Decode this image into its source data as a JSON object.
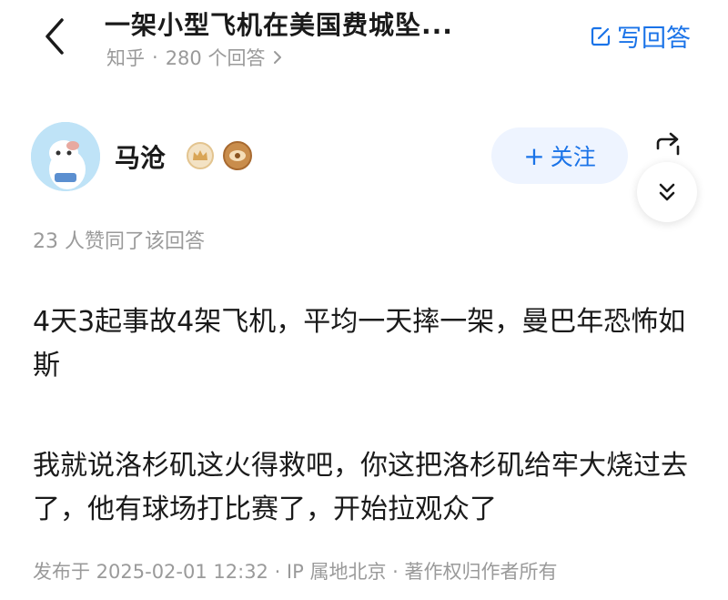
{
  "header": {
    "title": "一架小型飞机在美国费城坠...",
    "source": "知乎",
    "separator": "·",
    "answer_count": "280 个回答",
    "write_answer_label": "写回答",
    "accent_color": "#1a73e8"
  },
  "author": {
    "name": "马沧",
    "follow_label": "关注",
    "follow_plus": "+"
  },
  "answer": {
    "agree_text": "23 人赞同了该回答",
    "paragraphs": [
      "4天3起事故4架飞机，平均一天摔一架，曼巴年恐怖如斯",
      "我就说洛杉矶这火得救吧，你这把洛杉矶给牢大烧过去了，他有球场打比赛了，开始拉观众了"
    ],
    "footer": "发布于 2025-02-01 12:32 · IP 属地北京 · 著作权归作者所有"
  },
  "icons": {
    "back": "chevron-left-icon",
    "write": "edit-icon",
    "share": "share-icon",
    "more": "chevron-double-down-icon"
  }
}
